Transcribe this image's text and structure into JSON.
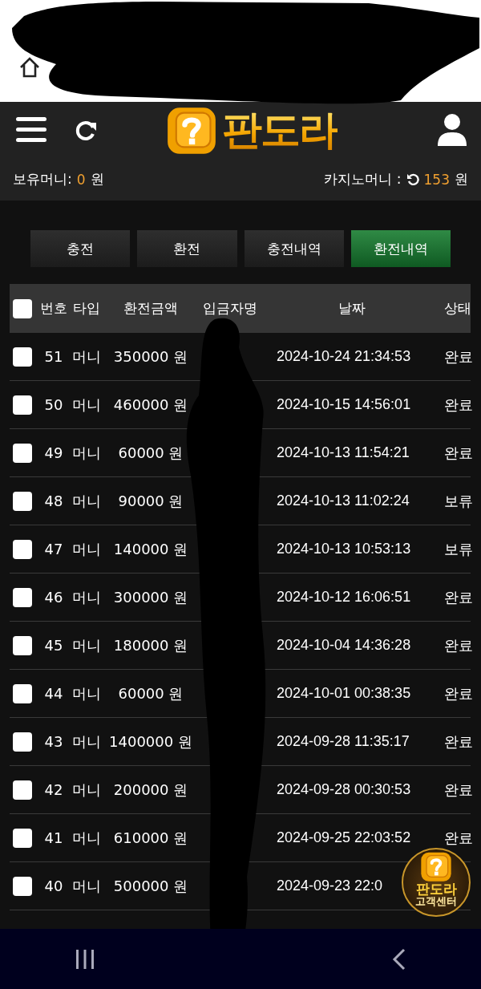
{
  "header": {
    "logo_text": "판도라"
  },
  "balance": {
    "holding_label": "보유머니:",
    "holding_value": "0",
    "holding_unit": "원",
    "casino_label": "카지노머니 :",
    "casino_value": "153",
    "casino_unit": "원"
  },
  "tabs": [
    {
      "label": "충전",
      "selected": false
    },
    {
      "label": "환전",
      "selected": false
    },
    {
      "label": "충전내역",
      "selected": false
    },
    {
      "label": "환전내역",
      "selected": true
    }
  ],
  "table": {
    "select_all_checked": false,
    "columns": [
      "번호",
      "타입",
      "환전금액",
      "입금자명",
      "날짜",
      "상태"
    ],
    "rows": [
      {
        "checked": false,
        "number": "51",
        "type": "머니",
        "amount": "350000 원",
        "date": "2024-10-24 21:34:53",
        "status": "완료"
      },
      {
        "checked": false,
        "number": "50",
        "type": "머니",
        "amount": "460000 원",
        "date": "2024-10-15 14:56:01",
        "status": "완료"
      },
      {
        "checked": false,
        "number": "49",
        "type": "머니",
        "amount": "60000 원",
        "date": "2024-10-13 11:54:21",
        "status": "완료"
      },
      {
        "checked": false,
        "number": "48",
        "type": "머니",
        "amount": "90000 원",
        "date": "2024-10-13 11:02:24",
        "status": "보류"
      },
      {
        "checked": false,
        "number": "47",
        "type": "머니",
        "amount": "140000 원",
        "date": "2024-10-13 10:53:13",
        "status": "보류"
      },
      {
        "checked": false,
        "number": "46",
        "type": "머니",
        "amount": "300000 원",
        "date": "2024-10-12 16:06:51",
        "status": "완료"
      },
      {
        "checked": false,
        "number": "45",
        "type": "머니",
        "amount": "180000 원",
        "date": "2024-10-04 14:36:28",
        "status": "완료"
      },
      {
        "checked": false,
        "number": "44",
        "type": "머니",
        "amount": "60000 원",
        "date": "2024-10-01 00:38:35",
        "status": "완료"
      },
      {
        "checked": false,
        "number": "43",
        "type": "머니",
        "amount": "1400000 원",
        "date": "2024-09-28 11:35:17",
        "status": "완료"
      },
      {
        "checked": false,
        "number": "42",
        "type": "머니",
        "amount": "200000 원",
        "date": "2024-09-28 00:30:53",
        "status": "완료"
      },
      {
        "checked": false,
        "number": "41",
        "type": "머니",
        "amount": "610000 원",
        "date": "2024-09-25 22:03:52",
        "status": "완료"
      },
      {
        "checked": false,
        "number": "40",
        "type": "머니",
        "amount": "500000 원",
        "date": "2024-09-23 22:0"
      }
    ]
  },
  "support_badge": {
    "title": "판도라",
    "subtitle": "고객센터"
  }
}
